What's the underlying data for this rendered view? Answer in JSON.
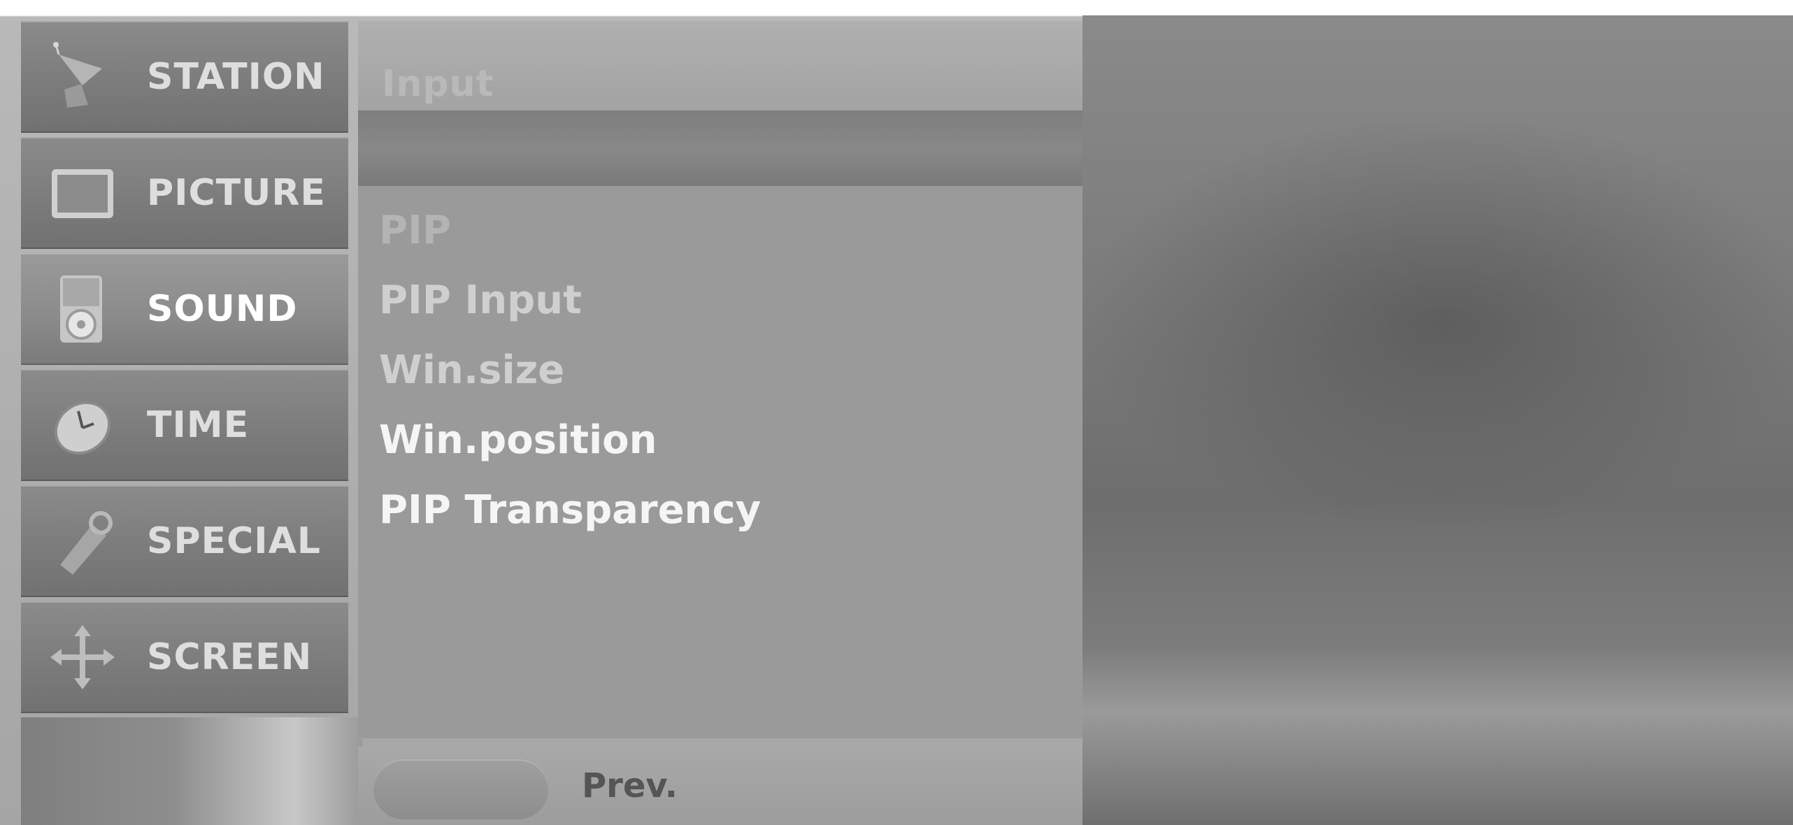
{
  "menu": {
    "items": [
      {
        "label": "STATION",
        "icon": "satellite-dish-icon",
        "active": false
      },
      {
        "label": "PICTURE",
        "icon": "tv-screen-icon",
        "active": false
      },
      {
        "label": "SOUND",
        "icon": "speaker-icon",
        "active": true
      },
      {
        "label": "TIME",
        "icon": "clock-icon",
        "active": false
      },
      {
        "label": "SPECIAL",
        "icon": "tag-icon",
        "active": false
      },
      {
        "label": "SCREEN",
        "icon": "move-arrows-icon",
        "active": false
      }
    ]
  },
  "panel": {
    "title": "Input",
    "options": [
      {
        "label": "PIP",
        "tone": "dim"
      },
      {
        "label": "PIP Input",
        "tone": "normal"
      },
      {
        "label": "Win.size",
        "tone": "normal"
      },
      {
        "label": "Win.position",
        "tone": "bright"
      },
      {
        "label": "PIP Transparency",
        "tone": "bright"
      }
    ]
  },
  "footer": {
    "prev_label": "Prev."
  }
}
